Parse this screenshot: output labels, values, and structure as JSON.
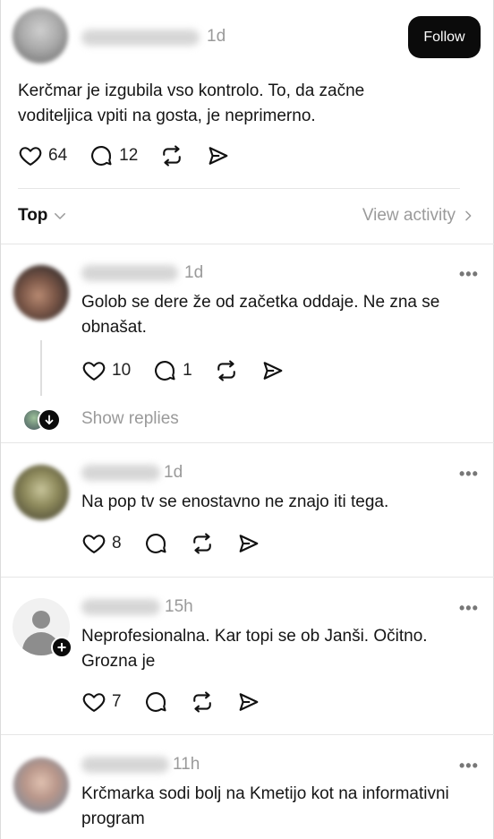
{
  "post": {
    "time": "1d",
    "text": "Kerčmar je izgubila vso kontrolo. To, da začne voditeljica vpiti na gosta, je neprimerno.",
    "likes": "64",
    "comments": "12",
    "follow_label": "Follow"
  },
  "sort": {
    "label": "Top",
    "view_activity": "View activity"
  },
  "replies": [
    {
      "time": "1d",
      "text": "Golob se dere že od začetka oddaje. Ne zna se obnašat.",
      "likes": "10",
      "comments": "1",
      "show_replies": "Show replies"
    },
    {
      "time": "1d",
      "text": "Na pop tv se enostavno ne znajo iti tega.",
      "likes": "8",
      "comments": ""
    },
    {
      "time": "15h",
      "text": "Neprofesionalna. Kar topi se ob Janši. Očitno. Grozna je",
      "likes": "7",
      "comments": ""
    },
    {
      "time": "11h",
      "text": "Krčmarka sodi bolj na Kmetijo kot na informativni program"
    }
  ],
  "colors": {
    "follow_bg": "#0b0b0b",
    "muted_text": "#9a9a9a",
    "divider": "#e6e6e6"
  },
  "icons": [
    "heart-icon",
    "comment-icon",
    "repost-icon",
    "share-icon",
    "chevron-down-icon",
    "chevron-right-icon",
    "more-icon",
    "arrow-down-icon",
    "plus-icon"
  ]
}
